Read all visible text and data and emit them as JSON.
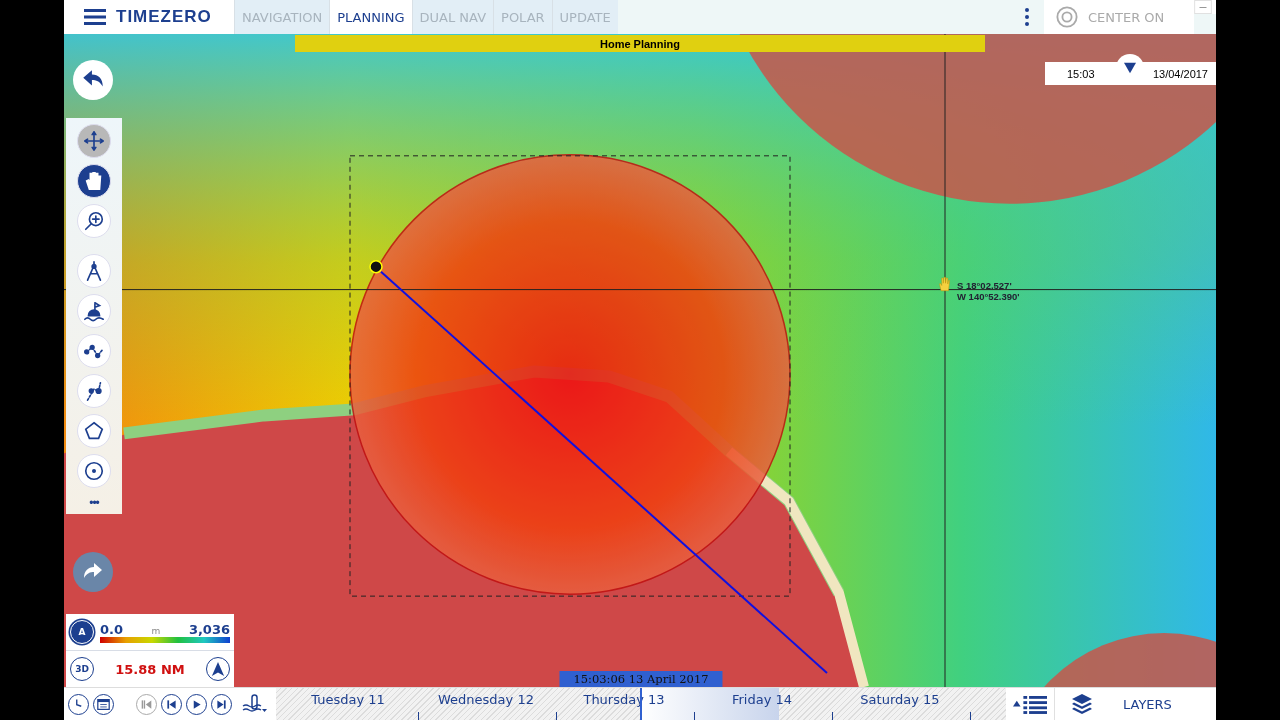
{
  "app": {
    "logo": "TIMEZERO"
  },
  "tabs": [
    {
      "label": "NAVIGATION",
      "selected": false
    },
    {
      "label": "PLANNING",
      "selected": true
    },
    {
      "label": "DUAL NAV",
      "selected": false
    },
    {
      "label": "POLAR",
      "selected": false
    },
    {
      "label": "UPDATE",
      "selected": false
    }
  ],
  "center_on": {
    "label": "CENTER ON"
  },
  "banner": {
    "title": "Home Planning"
  },
  "clock": {
    "time": "15:03",
    "date": "13/04/2017"
  },
  "cursor_position": {
    "lat": "S 18°02.527'",
    "lon": "W 140°52.390'"
  },
  "tools": [
    {
      "kind": "move",
      "selected": false
    },
    {
      "kind": "hand",
      "selected": true
    },
    {
      "kind": "zoom",
      "selected": false
    },
    {
      "kind": "compass",
      "selected": false
    },
    {
      "kind": "buoy",
      "selected": false
    },
    {
      "kind": "route",
      "selected": false
    },
    {
      "kind": "ebl",
      "selected": false
    },
    {
      "kind": "polygon",
      "selected": false
    },
    {
      "kind": "circle",
      "selected": false
    }
  ],
  "more": "•••",
  "depth_scale": {
    "mode": "A",
    "min": "0.0",
    "unit": "m",
    "max": "3,036"
  },
  "range": {
    "mode": "3D",
    "distance": "15.88 NM"
  },
  "playback": [
    {
      "kind": "first",
      "disabled": true
    },
    {
      "kind": "previous",
      "disabled": false
    },
    {
      "kind": "play",
      "disabled": false
    },
    {
      "kind": "next",
      "disabled": false
    }
  ],
  "timeline": {
    "days": [
      "Tuesday 11",
      "Wednesday 12",
      "Thursday 13",
      "Friday 14",
      "Saturday 15"
    ],
    "level": 0.5,
    "time_label": "15:03:06 13 April 2017"
  },
  "layers": {
    "label": "LAYERS"
  }
}
